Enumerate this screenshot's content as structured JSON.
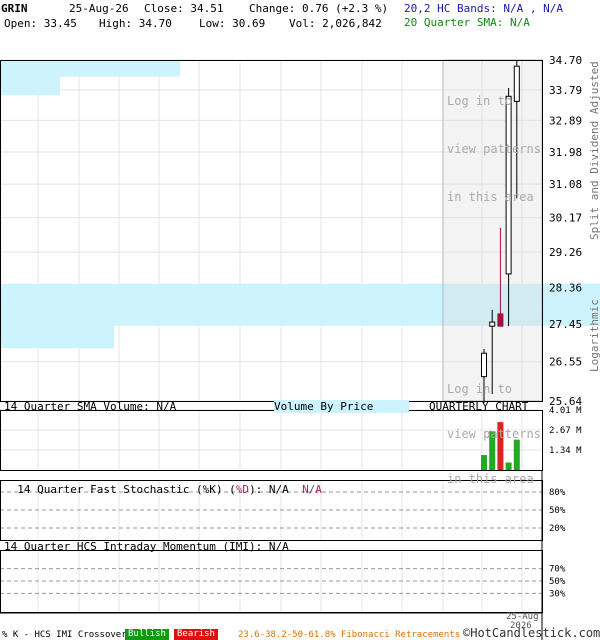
{
  "header": {
    "ticker": "GRIN",
    "date": "25-Aug-26",
    "close": "Close: 34.51",
    "change": "Change: 0.76 (+2.3 %)",
    "open": "Open: 33.45",
    "high": "High: 34.70",
    "low": "Low: 30.69",
    "vol": "Vol: 2,026,842",
    "hc_bands": "20,2 HC Bands: N/A , N/A",
    "sma20": "20 Quarter SMA: N/A"
  },
  "price_panel": {
    "side_label_1": "Split and Dividend Adjusted",
    "side_label_2": "Logarithmic",
    "login_top": [
      "Log in to",
      "view patterns",
      "in this area"
    ],
    "login_bottom": [
      "Log in to",
      "view patterns",
      "in this area"
    ]
  },
  "volume_panel": {
    "sma_label": "14 Quarter SMA Volume: N/A",
    "vbp_label": "Volume By Price",
    "chart_label": "QUARTERLY CHART"
  },
  "stoch_panel": {
    "label_main": "14 Quarter Fast Stochastic (",
    "label_k": "%K",
    "label_sep": ") (",
    "label_d": "%D",
    "label_tail": "): N/A",
    "label_na2": "N/A"
  },
  "imi_panel": {
    "label": "14 Quarter HCS Intraday Momentum (IMI): N/A"
  },
  "footer": {
    "x_tick_day": "25-Aug",
    "x_tick_year": "2026",
    "crossover": "% K - HCS IMI Crossover,",
    "bullish": "Bullish",
    "bearish": "Bearish",
    "fib": "23.6-38.2-50-61.8% Fibonacci Retracements",
    "copyright": "©HotCandlestick.com"
  },
  "colors": {
    "up": "#ffffff",
    "down": "#a0103a",
    "vbp": "#cdf3ff",
    "vol_up": "#22aa22",
    "vol_down": "#dd2222",
    "bullish": "#119911",
    "bearish": "#dd1111",
    "fib": "#e07000",
    "hc": "#1a1aaa",
    "sma": "#118811",
    "d_line": "#aa2266"
  },
  "chart_data": [
    {
      "type": "candlestick",
      "scale": "log",
      "ylim": [
        25.64,
        34.7
      ],
      "y_ticks": [
        "34.70",
        "33.79",
        "32.89",
        "31.98",
        "31.08",
        "30.17",
        "29.26",
        "28.36",
        "27.45",
        "26.55",
        "25.64"
      ],
      "candles": [
        {
          "open": 26.2,
          "high": 26.85,
          "low": 25.6,
          "close": 26.75
        },
        {
          "open": 27.4,
          "high": 27.8,
          "low": 25.8,
          "close": 27.5
        },
        {
          "open": 27.7,
          "high": 29.9,
          "low": 27.4,
          "close": 27.4
        },
        {
          "open": 28.7,
          "high": 33.85,
          "low": 27.4,
          "close": 33.6
        },
        {
          "open": 33.45,
          "high": 34.7,
          "low": 30.69,
          "close": 34.51
        }
      ],
      "volume_by_price": [
        {
          "low": 34.19,
          "high": 34.7,
          "relative": 0.3
        },
        {
          "low": 33.63,
          "high": 34.19,
          "relative": 0.1
        },
        {
          "low": 27.89,
          "high": 28.45,
          "relative": 1.0
        },
        {
          "low": 27.41,
          "high": 27.89,
          "relative": 1.0
        },
        {
          "low": 26.87,
          "high": 27.41,
          "relative": 0.19
        }
      ]
    },
    {
      "type": "bar",
      "title": "14 Quarter SMA Volume: N/A",
      "ylim": [
        0,
        4.01
      ],
      "y_ticks": [
        "4.01 M",
        "2.67 M",
        "1.34 M"
      ],
      "values": [
        1.0,
        2.6,
        3.2,
        0.5,
        2.03
      ],
      "colors": [
        "#22aa22",
        "#22aa22",
        "#dd2222",
        "#22aa22",
        "#22aa22"
      ]
    },
    {
      "type": "line",
      "title": "14 Quarter Fast Stochastic (%K) (%D): N/A",
      "y_ticks": [
        "80%",
        "50%",
        "20%"
      ],
      "reference_levels": [
        80,
        50,
        20
      ]
    },
    {
      "type": "line",
      "title": "14 Quarter HCS Intraday Momentum (IMI): N/A",
      "y_ticks": [
        "70%",
        "50%",
        "30%"
      ],
      "reference_levels": [
        70,
        50,
        30
      ]
    }
  ]
}
